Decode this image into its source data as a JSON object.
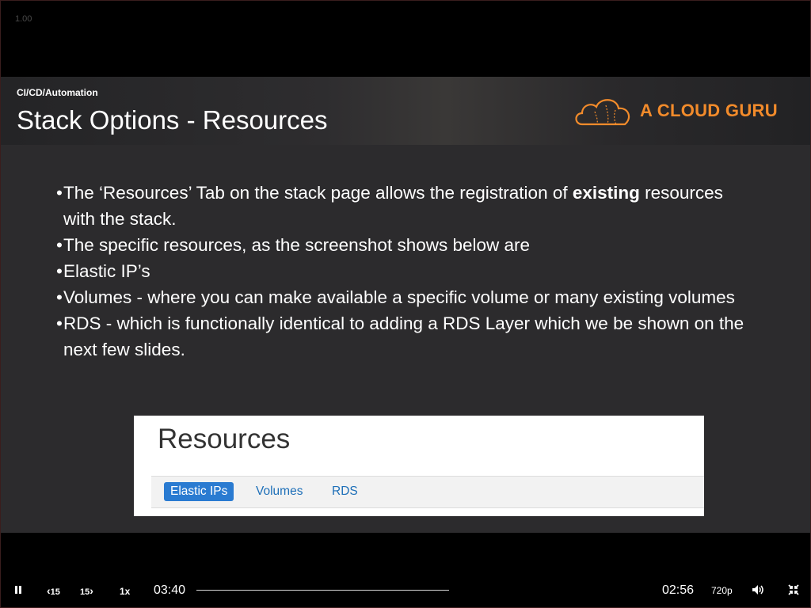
{
  "overlay": {
    "version_label": "1.00"
  },
  "slide": {
    "category": "CI/CD/Automation",
    "title": "Stack Options - Resources",
    "logo_text": "A CLOUD GURU",
    "bullets": [
      {
        "pre": "The ‘Resources’ Tab on the stack page allows the registration of ",
        "bold": "existing",
        "post": " resources with the stack."
      },
      {
        "pre": "The specific resources,  as the screenshot shows below are",
        "bold": "",
        "post": ""
      },
      {
        "pre": "Elastic IP’s",
        "bold": "",
        "post": ""
      },
      {
        "pre": "Volumes - where you can make available a specific volume or many existing volumes",
        "bold": "",
        "post": ""
      },
      {
        "pre": "RDS - which is functionally identical to adding a RDS Layer which we be shown on the next few slides.",
        "bold": "",
        "post": ""
      }
    ],
    "screenshot": {
      "title": "Resources",
      "tabs": [
        "Elastic IPs",
        "Volumes",
        "RDS"
      ],
      "active_tab": "Elastic IPs"
    }
  },
  "player": {
    "rewind_label": "15",
    "forward_label": "15",
    "speed_label": "1x",
    "elapsed": "03:40",
    "remaining": "02:56",
    "quality": "720p",
    "progress": 0.55,
    "icons": {
      "pause": "pause-icon",
      "rewind": "rewind-15-icon",
      "forward": "forward-15-icon",
      "volume": "volume-icon",
      "fullscreen": "exit-fullscreen-icon"
    },
    "accent_color": "#f28b2b"
  }
}
